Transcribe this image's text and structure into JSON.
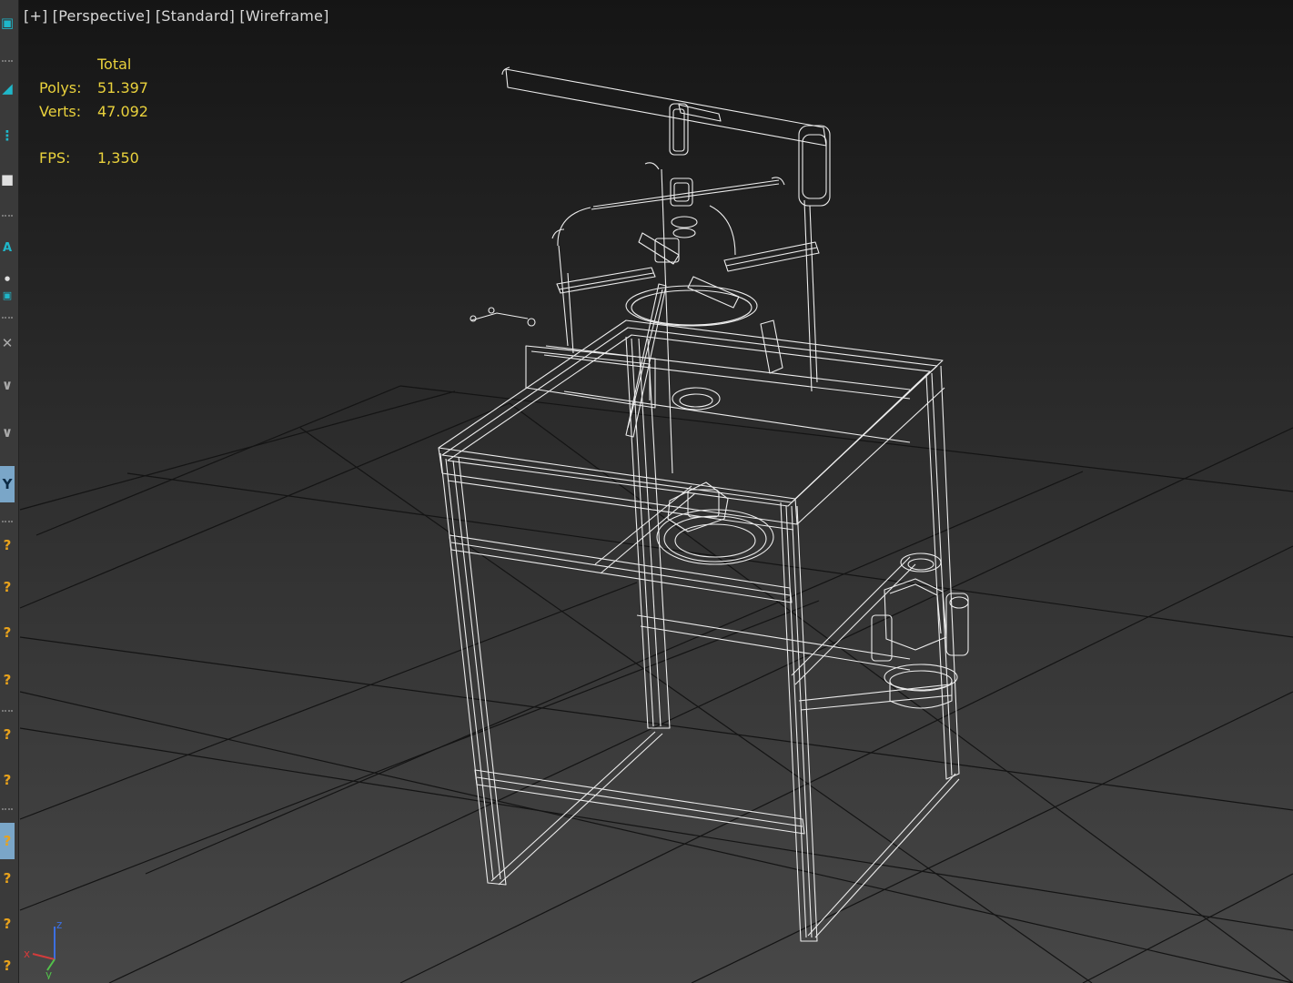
{
  "viewport": {
    "label_plus": "[+]",
    "label_view": "[Perspective]",
    "label_shading_std": "[Standard]",
    "label_shading_mode": "[Wireframe]"
  },
  "stats": {
    "header": "Total",
    "polys_label": "Polys:",
    "polys_value": "51.397",
    "verts_label": "Verts:",
    "verts_value": "47.092",
    "fps_label": "FPS:",
    "fps_value": "1,350"
  },
  "axis": {
    "x": "x",
    "y": "y",
    "z": "z",
    "colors": {
      "x": "#d23c3c",
      "y": "#52c24a",
      "z": "#3c6fe0"
    }
  },
  "toolbar_icons": [
    "select-object-icon",
    "cube-icon",
    "dots-icon",
    "square-icon",
    "text-icon",
    "dot-icon",
    "camera-icon",
    "light-icon",
    "shape-icon",
    "helper-icon",
    "y-constraint-icon",
    "help-icon",
    "help-icon",
    "help-icon",
    "help-icon",
    "help-icon",
    "help-icon",
    "help-icon",
    "help-icon",
    "help-icon"
  ],
  "colors": {
    "wire": "#ececec",
    "grid": "#141414",
    "stats_text": "#e9d13c",
    "label_text": "#d8d8d8",
    "accent_cyan": "#1fb7c9",
    "accent_orange": "#e8a21c"
  }
}
